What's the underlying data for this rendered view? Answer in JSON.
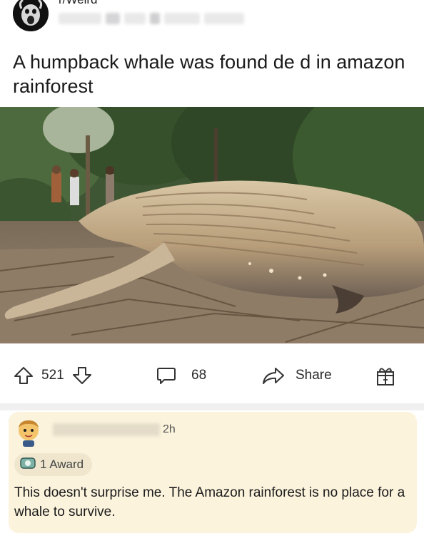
{
  "post": {
    "subreddit": "r/Weird",
    "title": "A humpback whale was found de  d in amazon rainforest"
  },
  "actions": {
    "upvotes": "521",
    "comments": "68",
    "share_label": "Share"
  },
  "comment": {
    "time": "2h",
    "award_label": "1 Award",
    "body": "This doesn't surprise me. The Amazon rainforest is no place for a whale to survive."
  },
  "colors": {
    "comment_bg": "#fbf3dc",
    "award_bg": "#efe6cd",
    "divider": "#f0f0f1"
  },
  "icons": [
    "upvote-icon",
    "downvote-icon",
    "comment-icon",
    "share-icon",
    "gift-award-icon",
    "award-icon"
  ]
}
